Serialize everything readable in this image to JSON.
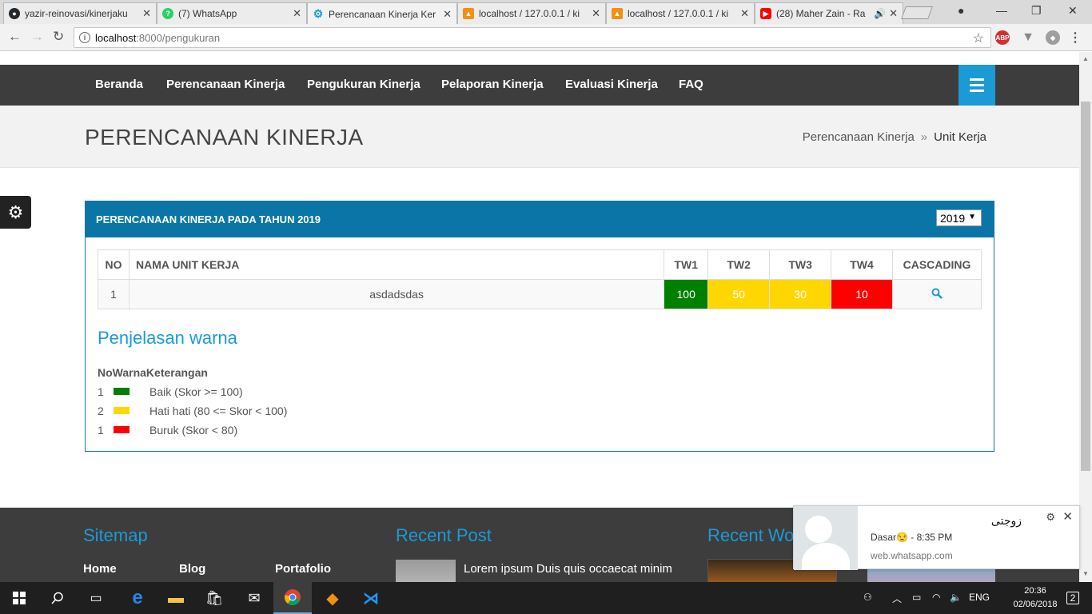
{
  "browser": {
    "tabs": [
      {
        "title": "yazir-reinovasi/kinerjaku",
        "icon": "github-icon",
        "color": "#24292e"
      },
      {
        "title": "(7) WhatsApp",
        "icon": "whatsapp-icon",
        "color": "#25d366"
      },
      {
        "title": "Perencanaan Kinerja Ker",
        "icon": "gear-icon",
        "color": "#1b9ad6"
      },
      {
        "title": "localhost / 127.0.0.1 / ki",
        "icon": "phpmyadmin-icon",
        "color": "#f29111"
      },
      {
        "title": "localhost / 127.0.0.1 / ki",
        "icon": "phpmyadmin-icon",
        "color": "#f29111"
      },
      {
        "title": "(28) Maher Zain - Ra",
        "icon": "youtube-icon",
        "color": "#ff0000"
      }
    ],
    "url_host": "localhost",
    "url_path": ":8000/pengukuran"
  },
  "nav": {
    "items": [
      "Beranda",
      "Perencanaan Kinerja",
      "Pengukuran Kinerja",
      "Pelaporan Kinerja",
      "Evaluasi Kinerja",
      "FAQ"
    ]
  },
  "page_header": {
    "title": "PERENCANAAN KINERJA",
    "breadcrumb_parent": "Perencanaan Kinerja",
    "breadcrumb_sep": "»",
    "breadcrumb_current": "Unit Kerja"
  },
  "panel": {
    "title": "PERENCANAAN KINERJA PADA TAHUN 2019",
    "year_selected": "2019"
  },
  "table": {
    "headers": [
      "NO",
      "NAMA UNIT KERJA",
      "TW1",
      "TW2",
      "TW3",
      "TW4",
      "CASCADING"
    ],
    "rows": [
      {
        "no": "1",
        "name": "asdadsdas",
        "tw1": "100",
        "tw2": "50",
        "tw3": "30",
        "tw4": "10"
      }
    ]
  },
  "colors": {
    "good": "#008000",
    "caution": "#ffd700",
    "bad": "#ff0000",
    "accent": "#1b9ad6",
    "panel": "#0b75a8"
  },
  "legend": {
    "title": "Penjelasan warna",
    "header": "NoWarnaKeterangan",
    "rows": [
      {
        "no": "1",
        "ket": "Baik (Skor >= 100)",
        "color": "#008000"
      },
      {
        "no": "2",
        "ket": "Hati hati (80 <= Skor < 100)",
        "color": "#ffd700"
      },
      {
        "no": "1",
        "ket": "Buruk (Skor < 80)",
        "color": "#ff0000"
      }
    ]
  },
  "footer": {
    "sitemap": "Sitemap",
    "recent_post": "Recent Post",
    "recent_work": "Recent Wo",
    "links": [
      "Home",
      "Blog",
      "Portafolio"
    ],
    "post_text": "Lorem ipsum Duis quis occaecat minim"
  },
  "notification": {
    "name": "زوجتى",
    "message": "Dasar😒 - 8:35 PM",
    "source": "web.whatsapp.com"
  },
  "taskbar": {
    "lang": "ENG",
    "time": "20:36",
    "date": "02/06/2018",
    "notif_count": "2"
  }
}
